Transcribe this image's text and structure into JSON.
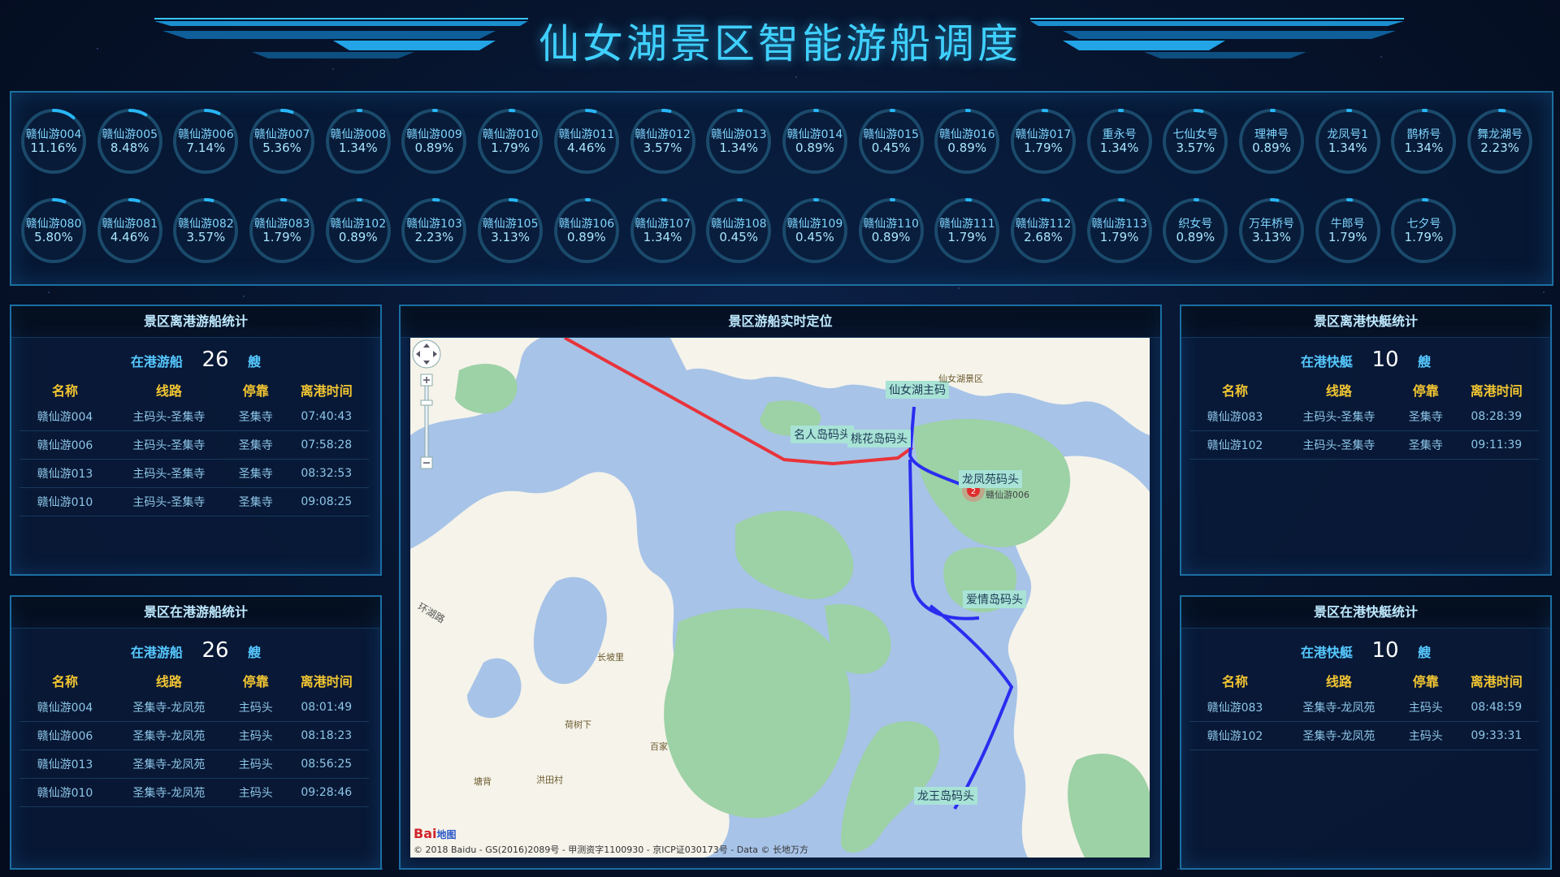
{
  "header": {
    "title": "仙女湖景区智能游船调度"
  },
  "boats_top": [
    {
      "name": "赣仙游004",
      "pct": "11.16%",
      "v": 11.16
    },
    {
      "name": "赣仙游005",
      "pct": "8.48%",
      "v": 8.48
    },
    {
      "name": "赣仙游006",
      "pct": "7.14%",
      "v": 7.14
    },
    {
      "name": "赣仙游007",
      "pct": "5.36%",
      "v": 5.36
    },
    {
      "name": "赣仙游008",
      "pct": "1.34%",
      "v": 1.34
    },
    {
      "name": "赣仙游009",
      "pct": "0.89%",
      "v": 0.89
    },
    {
      "name": "赣仙游010",
      "pct": "1.79%",
      "v": 1.79
    },
    {
      "name": "赣仙游011",
      "pct": "4.46%",
      "v": 4.46
    },
    {
      "name": "赣仙游012",
      "pct": "3.57%",
      "v": 3.57
    },
    {
      "name": "赣仙游013",
      "pct": "1.34%",
      "v": 1.34
    },
    {
      "name": "赣仙游014",
      "pct": "0.89%",
      "v": 0.89
    },
    {
      "name": "赣仙游015",
      "pct": "0.45%",
      "v": 0.45
    },
    {
      "name": "赣仙游016",
      "pct": "0.89%",
      "v": 0.89
    },
    {
      "name": "赣仙游017",
      "pct": "1.79%",
      "v": 1.79
    },
    {
      "name": "重永号",
      "pct": "1.34%",
      "v": 1.34
    },
    {
      "name": "七仙女号",
      "pct": "3.57%",
      "v": 3.57
    },
    {
      "name": "理神号",
      "pct": "0.89%",
      "v": 0.89
    },
    {
      "name": "龙凤号1",
      "pct": "1.34%",
      "v": 1.34
    },
    {
      "name": "鹊桥号",
      "pct": "1.34%",
      "v": 1.34
    },
    {
      "name": "舞龙湖号",
      "pct": "2.23%",
      "v": 2.23
    }
  ],
  "boats_bottom": [
    {
      "name": "赣仙游080",
      "pct": "5.80%",
      "v": 5.8
    },
    {
      "name": "赣仙游081",
      "pct": "4.46%",
      "v": 4.46
    },
    {
      "name": "赣仙游082",
      "pct": "3.57%",
      "v": 3.57
    },
    {
      "name": "赣仙游083",
      "pct": "1.79%",
      "v": 1.79
    },
    {
      "name": "赣仙游102",
      "pct": "0.89%",
      "v": 0.89
    },
    {
      "name": "赣仙游103",
      "pct": "2.23%",
      "v": 2.23
    },
    {
      "name": "赣仙游105",
      "pct": "3.13%",
      "v": 3.13
    },
    {
      "name": "赣仙游106",
      "pct": "0.89%",
      "v": 0.89
    },
    {
      "name": "赣仙游107",
      "pct": "1.34%",
      "v": 1.34
    },
    {
      "name": "赣仙游108",
      "pct": "0.45%",
      "v": 0.45
    },
    {
      "name": "赣仙游109",
      "pct": "0.45%",
      "v": 0.45
    },
    {
      "name": "赣仙游110",
      "pct": "0.89%",
      "v": 0.89
    },
    {
      "name": "赣仙游111",
      "pct": "1.79%",
      "v": 1.79
    },
    {
      "name": "赣仙游112",
      "pct": "2.68%",
      "v": 2.68
    },
    {
      "name": "赣仙游113",
      "pct": "1.79%",
      "v": 1.79
    },
    {
      "name": "织女号",
      "pct": "0.89%",
      "v": 0.89
    },
    {
      "name": "万年桥号",
      "pct": "3.13%",
      "v": 3.13
    },
    {
      "name": "牛郎号",
      "pct": "1.79%",
      "v": 1.79
    },
    {
      "name": "七夕号",
      "pct": "1.79%",
      "v": 1.79
    }
  ],
  "panel_left_top": {
    "title": "景区离港游船统计",
    "count_label": "在港游船",
    "count": "26",
    "unit": "艘",
    "headers": [
      "名称",
      "线路",
      "停靠",
      "离港时间"
    ],
    "rows": [
      [
        "赣仙游004",
        "主码头-圣集寺",
        "圣集寺",
        "07:40:43"
      ],
      [
        "赣仙游006",
        "主码头-圣集寺",
        "圣集寺",
        "07:58:28"
      ],
      [
        "赣仙游013",
        "主码头-圣集寺",
        "圣集寺",
        "08:32:53"
      ],
      [
        "赣仙游010",
        "主码头-圣集寺",
        "圣集寺",
        "09:08:25"
      ]
    ]
  },
  "panel_left_bottom": {
    "title": "景区在港游船统计",
    "count_label": "在港游船",
    "count": "26",
    "unit": "艘",
    "headers": [
      "名称",
      "线路",
      "停靠",
      "离港时间"
    ],
    "rows": [
      [
        "赣仙游004",
        "圣集寺-龙凤苑",
        "主码头",
        "08:01:49"
      ],
      [
        "赣仙游006",
        "圣集寺-龙凤苑",
        "主码头",
        "08:18:23"
      ],
      [
        "赣仙游013",
        "圣集寺-龙凤苑",
        "主码头",
        "08:56:25"
      ],
      [
        "赣仙游010",
        "圣集寺-龙凤苑",
        "主码头",
        "09:28:46"
      ]
    ]
  },
  "panel_right_top": {
    "title": "景区离港快艇统计",
    "count_label": "在港快艇",
    "count": "10",
    "unit": "艘",
    "headers": [
      "名称",
      "线路",
      "停靠",
      "离港时间"
    ],
    "rows": [
      [
        "赣仙游083",
        "主码头-圣集寺",
        "圣集寺",
        "08:28:39"
      ],
      [
        "赣仙游102",
        "主码头-圣集寺",
        "圣集寺",
        "09:11:39"
      ]
    ]
  },
  "panel_right_bottom": {
    "title": "景区在港快艇统计",
    "count_label": "在港快艇",
    "count": "10",
    "unit": "艘",
    "headers": [
      "名称",
      "线路",
      "停靠",
      "离港时间"
    ],
    "rows": [
      [
        "赣仙游083",
        "圣集寺-龙凤苑",
        "主码头",
        "08:48:59"
      ],
      [
        "赣仙游102",
        "圣集寺-龙凤苑",
        "主码头",
        "09:33:31"
      ]
    ]
  },
  "map": {
    "title": "景区游船实时定位",
    "piers": {
      "main": "仙女湖主码",
      "mingren": "名人岛码头",
      "taohua": "桃花岛码头",
      "longfeng": "龙凤苑码头",
      "aiqing": "爱情岛码头",
      "longwang": "龙王岛码头"
    },
    "scenic_label": "仙女湖景区",
    "marker_count": "2",
    "marker_boat": "赣仙游006",
    "places": {
      "huanhu": "环湖路",
      "changpo": "长坡里",
      "heshu": "荷树下",
      "baijia": "百家",
      "tangshang": "塘背",
      "hongtian": "洪田村"
    },
    "logo_text": "Bai",
    "logo_sub": "地图",
    "copyright": "© 2018 Baidu - GS(2016)2089号 - 甲测资字1100930 - 京ICP证030173号 - Data © 长地万方"
  },
  "colors": {
    "accent": "#3fd0ff",
    "route_red": "#e8343a",
    "route_blue": "#2a2df0",
    "land": "#f5f3ea",
    "island": "#9dd1a6",
    "water": "#a7c3e8"
  }
}
